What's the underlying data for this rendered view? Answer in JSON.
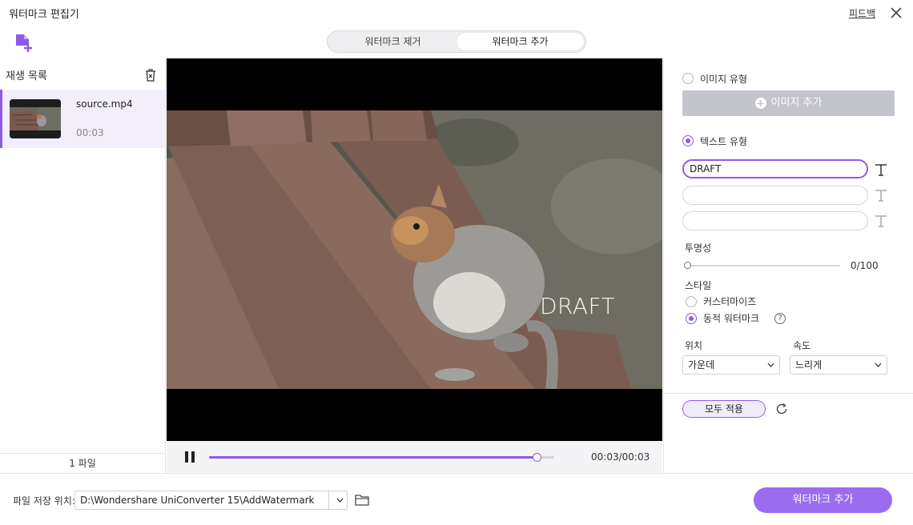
{
  "window": {
    "title": "워터마크 편집기",
    "feedback_label": "피드백"
  },
  "tabs": [
    {
      "label": "워터마크 제거",
      "active": false
    },
    {
      "label": "워터마크 추가",
      "active": true
    }
  ],
  "playlist": {
    "title": "재생 목록",
    "items": [
      {
        "filename": "source.mp4",
        "duration": "00:03"
      }
    ],
    "footer": "1 파일"
  },
  "player": {
    "watermark_overlay": "DRAFT",
    "progress": 0.95,
    "time": "00:03/00:03"
  },
  "settings": {
    "image_type": {
      "label": "이미지 유형",
      "selected": false,
      "add_button": "이미지 추가"
    },
    "text_type": {
      "label": "텍스트 유형",
      "selected": true
    },
    "text_fields": [
      "DRAFT",
      "",
      ""
    ],
    "opacity": {
      "label": "투명성",
      "value": 0,
      "max": 100,
      "readout": "0/100"
    },
    "style": {
      "label": "스타일",
      "options": [
        {
          "label": "커스터마이즈",
          "selected": false
        },
        {
          "label": "동적 워터마크",
          "selected": true
        }
      ]
    },
    "position": {
      "label": "위치",
      "value": "가운데"
    },
    "speed": {
      "label": "속도",
      "value": "느리게"
    },
    "apply_all": "모두 적용"
  },
  "footer": {
    "save_label": "파일 저장 위치:",
    "save_path": "D:\\Wondershare UniConverter 15\\AddWatermark",
    "primary_button": "워터마크 추가"
  },
  "colors": {
    "accent": "#8e5be8",
    "primary_button": "#9b6cf0",
    "disabled_button": "#c4c4cc"
  }
}
